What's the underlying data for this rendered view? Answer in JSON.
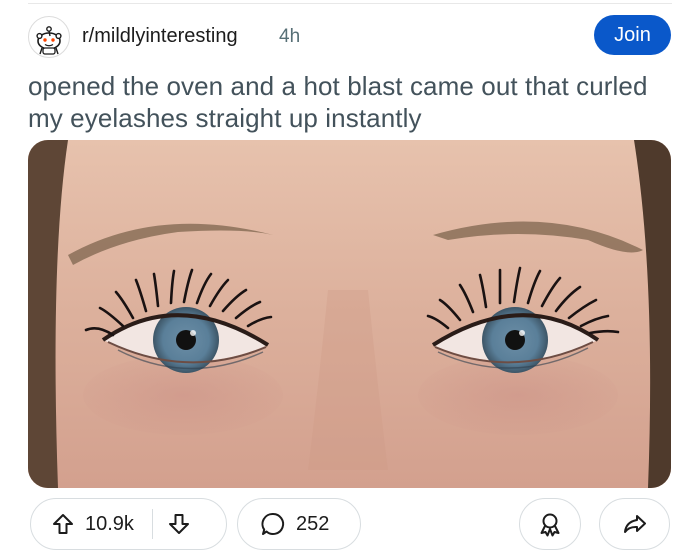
{
  "post": {
    "subreddit": "r/mildlyinteresting",
    "time_ago": "4h",
    "join_label": "Join",
    "title": "opened the oven and a hot blast came out that curled my eyelashes straight up instantly"
  },
  "actions": {
    "upvotes": "10.9k",
    "comments": "252"
  },
  "icons": {
    "avatar": "reddit-snoo-icon",
    "upvote": "arrow-up-icon",
    "downvote": "arrow-down-icon",
    "comment": "speech-bubble-icon",
    "award": "award-ribbon-icon",
    "share": "share-arrow-icon"
  },
  "colors": {
    "join_button": "#0a58ca",
    "title_text": "#43525b",
    "meta_text": "#576f76",
    "pill_border": "#d8dde0"
  }
}
